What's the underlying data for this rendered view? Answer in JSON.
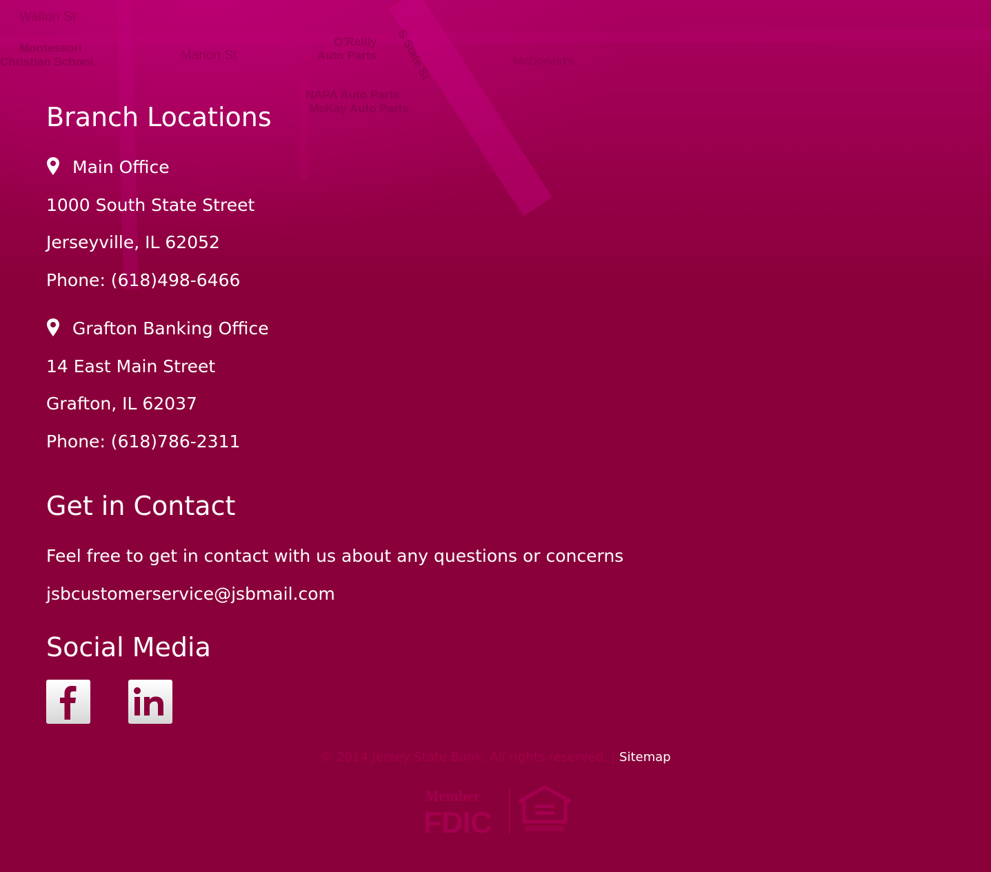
{
  "map_labels": [
    "Walton St",
    "Montessori",
    "Christian School",
    "Marion St",
    "O'Reilly",
    "Auto Parts",
    "McDonald's",
    "NAPA Auto Parts",
    "McKay Auto Parts",
    "S State St"
  ],
  "branch": {
    "heading": "Branch Locations",
    "offices": [
      {
        "name": "Main Office",
        "address": "1000 South State Street",
        "city": "Jerseyville, IL 62052",
        "phone": "Phone: (618)498-6466"
      },
      {
        "name": "Grafton Banking Office",
        "address": "14 East Main Street",
        "city": "Grafton, IL 62037",
        "phone": "Phone: (618)786-2311"
      }
    ]
  },
  "contact": {
    "heading": "Get in Contact",
    "text": "Feel free to get in contact with us about any questions or concerns",
    "email": "jsbcustomerservice@jsbmail.com"
  },
  "social": {
    "heading": "Social Media",
    "facebook_icon": "facebook-icon",
    "linkedin_icon": "linkedin-icon"
  },
  "footer": {
    "copyright": "© 2014 Jersey State Bank. All rights reserved. |",
    "sitemap": "Sitemap",
    "fdic_line1": "Member",
    "fdic_line2": "FDIC"
  },
  "colors": {
    "background": "#8a003a",
    "accent": "#b0006a",
    "text": "#ffffff"
  }
}
